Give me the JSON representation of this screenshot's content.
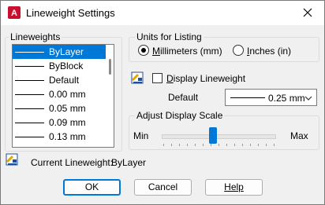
{
  "window": {
    "title": "Lineweight Settings"
  },
  "lineweights": {
    "legend": "Lineweights",
    "items": [
      "ByLayer",
      "ByBlock",
      "Default",
      "0.00 mm",
      "0.05 mm",
      "0.09 mm",
      "0.13 mm"
    ],
    "selected": "ByLayer"
  },
  "units": {
    "legend": "Units for Listing",
    "millimeters_label": "Millimeters (mm)",
    "inches_label": "Inches (in)",
    "selected": "Millimeters (mm)"
  },
  "display_lineweight": {
    "label": "Display Lineweight",
    "checked": false
  },
  "default_field": {
    "label": "Default",
    "value": "0.25 mm"
  },
  "scale": {
    "legend": "Adjust Display Scale",
    "min_label": "Min",
    "max_label": "Max",
    "level": 0.45
  },
  "current": {
    "label": "Current Lineweight:",
    "value": "ByLayer"
  },
  "buttons": {
    "ok": "OK",
    "cancel": "Cancel",
    "help": "Help"
  },
  "colors": {
    "accent": "#0078d7",
    "app_icon": "#c8102e"
  },
  "icons": {
    "app": "autocad-logo-icon",
    "close": "close-icon",
    "dropdown": "chevron-down-icon",
    "info": "lineweight-icon"
  }
}
